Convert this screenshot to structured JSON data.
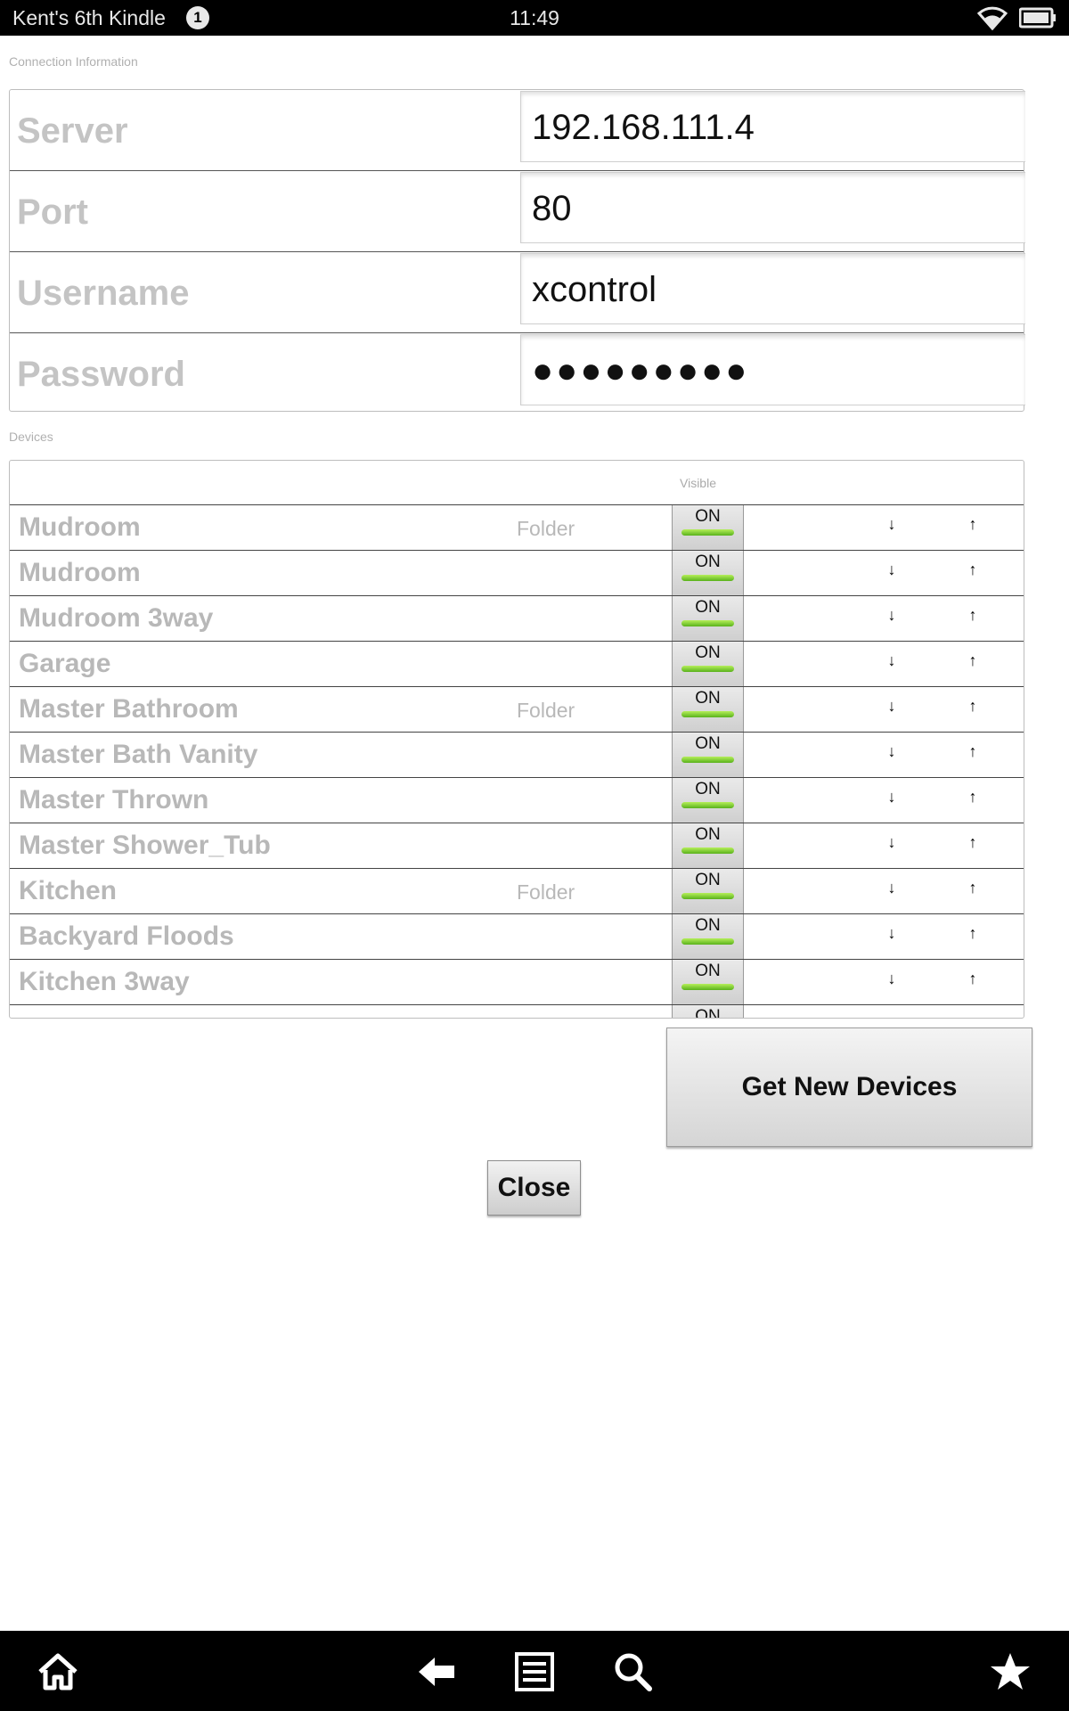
{
  "status_bar": {
    "device_name": "Kent's 6th Kindle",
    "notification_count": "1",
    "time": "11:49"
  },
  "connection": {
    "section_label": "Connection Information",
    "fields": [
      {
        "label": "Server",
        "value": "192.168.111.4"
      },
      {
        "label": "Port",
        "value": "80"
      },
      {
        "label": "Username",
        "value": "xcontrol"
      },
      {
        "label": "Password",
        "value": "●●●●●●●●●"
      }
    ]
  },
  "devices": {
    "section_label": "Devices",
    "visible_header": "Visible",
    "toggle_text": "ON",
    "arrow_down": "↓",
    "arrow_up": "↑",
    "rows": [
      {
        "name": "Mudroom",
        "type": "Folder"
      },
      {
        "name": "Mudroom",
        "type": ""
      },
      {
        "name": "Mudroom 3way",
        "type": ""
      },
      {
        "name": "Garage",
        "type": ""
      },
      {
        "name": "Master Bathroom",
        "type": "Folder"
      },
      {
        "name": "Master Bath Vanity",
        "type": ""
      },
      {
        "name": "Master Thrown",
        "type": ""
      },
      {
        "name": "Master Shower_Tub",
        "type": ""
      },
      {
        "name": "Kitchen",
        "type": "Folder"
      },
      {
        "name": "Backyard Floods",
        "type": ""
      },
      {
        "name": "Kitchen 3way",
        "type": ""
      },
      {
        "name": "",
        "type": ""
      }
    ]
  },
  "buttons": {
    "get_new_devices": "Get New Devices",
    "close": "Close"
  },
  "nav_bar": {
    "icons": [
      "home-icon",
      "back-icon",
      "menu-icon",
      "search-icon",
      "favorites-icon"
    ]
  }
}
